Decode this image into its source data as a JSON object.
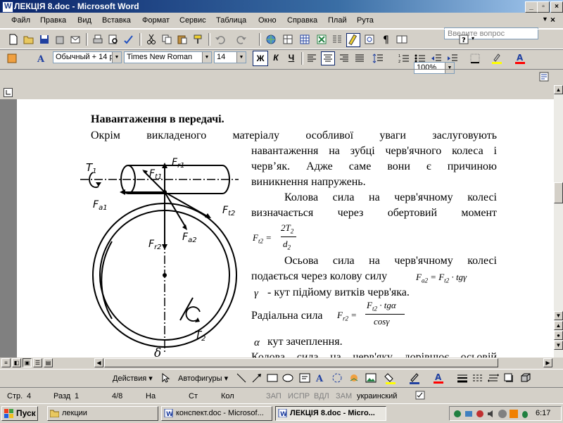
{
  "window": {
    "title": "ЛЕКЦІЯ 8.doc - Microsoft Word"
  },
  "menu": [
    "Файл",
    "Правка",
    "Вид",
    "Вставка",
    "Формат",
    "Сервис",
    "Таблица",
    "Окно",
    "Справка",
    "Плай",
    "Рута"
  ],
  "help_box": {
    "placeholder": "Введите вопрос"
  },
  "toolbar": {
    "zoom": "100%"
  },
  "format": {
    "style": "Обычный + 14 р",
    "font": "Times New Roman",
    "size": "14",
    "bold": "Ж",
    "italic": "К",
    "underline": "Ч"
  },
  "document": {
    "heading": "Навантаження в передачі.",
    "p1_line1": "Окрім викладеного матеріалу особливої уваги заслуговують",
    "p1_line2": "навантаження на зубці черв'ячного колеса і",
    "p1_line3": "черв’як. Адже саме вони є причиною",
    "p1_line4": "виникнення напружень.",
    "p2_line1": "Колова сила на черв'ячному колесі",
    "p2_line2": "визначається через обертовий момент",
    "f1_lhs": "F",
    "f1_lhs_sub": "t2",
    "f1_num": "2T",
    "f1_num_sub": "2",
    "f1_den": "d",
    "f1_den_sub": "2",
    "p3_line1": "Осьова сила на черв'ячному колесі",
    "p3_line2": "подається через колову силу",
    "f2": "F",
    "f2_sub": "a2",
    "f2_rhs": "= F",
    "f2_rhs_sub": "t2",
    "f2_tail": "· tgγ",
    "gamma_sym": "γ",
    "gamma_text": "- кут підйому витків черв'яка.",
    "radial_label": "Радіальна сила",
    "f3_lhs": "F",
    "f3_lhs_sub": "r2",
    "f3_num": "F",
    "f3_num_sub": "t2",
    "f3_num_tail": " · tgα",
    "f3_den": "cosγ",
    "alpha_sym": "α",
    "alpha_text": "кут зачеплення.",
    "last_line": "Колова сила на черв'яку дорівнює осьовій"
  },
  "diagram_labels": {
    "T1": "T",
    "T1_sub": "1",
    "Fr1": "F",
    "Fr1_sub": "r1",
    "Ft1": "F",
    "Ft1_sub": "t1",
    "Fa1": "F",
    "Fa1_sub": "a1",
    "Ft2": "F",
    "Ft2_sub": "t2",
    "Fr2": "F",
    "Fr2_sub": "r2",
    "Fa2": "F",
    "Fa2_sub": "a2",
    "T2": "T",
    "T2_sub": "2",
    "delta": "δ"
  },
  "drawbar": {
    "actions": "Действия",
    "autoshapes": "Автофигуры"
  },
  "status": {
    "page": "Стр.",
    "page_no": "4",
    "section": "Разд",
    "section_no": "1",
    "pages": "4/8",
    "at": "На",
    "line": "Ст",
    "col": "Кол",
    "rec": "ЗАП",
    "trk": "ИСПР",
    "ext": "ВДЛ",
    "ovr": "ЗАМ",
    "lang": "украинский"
  },
  "taskbar": {
    "start": "Пуск",
    "tasks": [
      "лекции",
      "конспект.doc - Microsof...",
      "ЛЕКЦІЯ 8.doc - Micro..."
    ],
    "clock": "6:17"
  },
  "colors": {
    "title_bar": "#0a246a",
    "highlight": "#ffff00",
    "font_color": "#ff0000"
  }
}
